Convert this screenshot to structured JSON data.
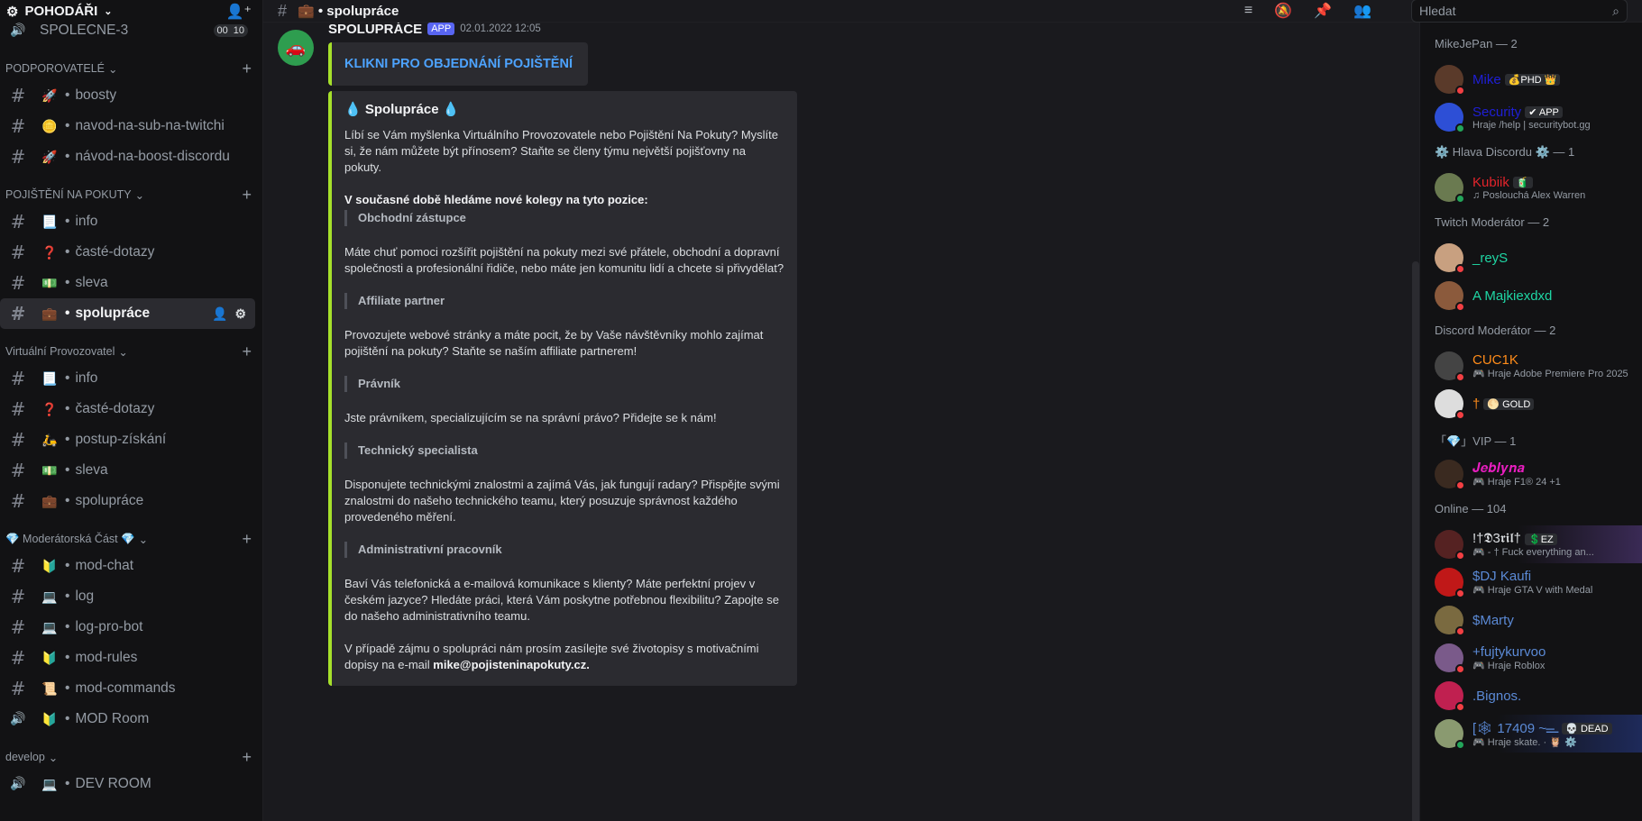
{
  "server": {
    "name": "POHODÁŘI"
  },
  "topbar": {
    "channel": "💼 • spolupráce",
    "search_placeholder": "Hledat"
  },
  "sidebar": {
    "top_channel": {
      "name": "SPOLECNE-3",
      "counts": [
        "00",
        "10"
      ]
    },
    "categories": [
      {
        "label": "PODPOROVATELÉ",
        "channels": [
          {
            "emoji": "🚀",
            "name": "boosty"
          },
          {
            "emoji": "🪙",
            "name": "navod-na-sub-na-twitchi"
          },
          {
            "emoji": "🚀",
            "name": "návod-na-boost-discordu"
          }
        ]
      },
      {
        "label": "POJIŠTĚNÍ NA POKUTY",
        "channels": [
          {
            "emoji": "📃",
            "name": "info"
          },
          {
            "emoji": "❓",
            "name": "časté-dotazy"
          },
          {
            "emoji": "💵",
            "name": "sleva"
          },
          {
            "emoji": "💼",
            "name": "spolupráce",
            "active": true
          }
        ]
      },
      {
        "label": "Virtuální Provozovatel",
        "channels": [
          {
            "emoji": "📃",
            "name": "info"
          },
          {
            "emoji": "❓",
            "name": "časté-dotazy"
          },
          {
            "emoji": "🛵",
            "name": "postup-získání"
          },
          {
            "emoji": "💵",
            "name": "sleva"
          },
          {
            "emoji": "💼",
            "name": "spolupráce"
          }
        ]
      },
      {
        "label": "💎 Moderátorská Část 💎",
        "channels": [
          {
            "emoji": "🔰",
            "name": "mod-chat"
          },
          {
            "emoji": "💻",
            "name": "log"
          },
          {
            "emoji": "💻",
            "name": "log-pro-bot"
          },
          {
            "emoji": "🔰",
            "name": "mod-rules"
          },
          {
            "emoji": "📜",
            "name": "mod-commands"
          },
          {
            "emoji": "🔰",
            "name": "MOD Room",
            "voice": true
          }
        ]
      },
      {
        "label": "develop",
        "channels": [
          {
            "emoji": "💻",
            "name": "DEV ROOM",
            "voice": true
          }
        ]
      }
    ]
  },
  "message": {
    "author": "SPOLUPRÁCE",
    "tag": "APP",
    "timestamp": "02.01.2022 12:05",
    "button_text": "KLIKNI PRO OBJEDNÁNÍ POJIŠTĚNÍ",
    "embed": {
      "title": "💧 Spolupráce 💧",
      "intro": "Líbí se Vám myšlenka Virtuálního Provozovatele nebo Pojištění Na Pokuty? Myslíte si, že nám můžete být přínosem? Staňte se členy týmu největší pojišťovny na pokuty.",
      "heading": "V současné době hledáme nové kolegy na tyto pozice:",
      "positions": [
        {
          "title": "Obchodní zástupce",
          "text": "Máte chuť pomoci rozšířit pojištění na pokuty mezi své přátele, obchodní a dopravní společnosti a profesionální řidiče, nebo máte jen komunitu lidí a chcete si přivydělat?"
        },
        {
          "title": "Affiliate partner",
          "text": "Provozujete webové stránky a máte pocit, že by Vaše návštěvníky mohlo zajímat pojištění na pokuty? Staňte se naším affiliate partnerem!"
        },
        {
          "title": "Právník",
          "text": "Jste právníkem, specializujícím se na správní právo? Přidejte se k nám!"
        },
        {
          "title": "Technický specialista",
          "text": "Disponujete technickými znalostmi a zajímá Vás, jak fungují radary? Přispějte svými znalostmi do našeho technického teamu, který posuzuje správnost každého provedeného měření."
        },
        {
          "title": "Administrativní pracovník",
          "text": "Baví Vás telefonická a e-mailová komunikace s klienty? Máte perfektní projev v českém jazyce? Hledáte práci, která Vám poskytne potřebnou flexibilitu? Zapojte se do našeho administrativního teamu."
        }
      ],
      "outro": "V případě zájmu o spolupráci nám prosím zasílejte své životopisy s motivačními dopisy na e-mail",
      "email": "mike@pojisteninapokuty.cz."
    }
  },
  "members": [
    {
      "label": "MikeJePan — 2",
      "list": [
        {
          "name": "Mike",
          "color": "#1f1fd6",
          "tag": "💰PHD 👑",
          "status": "dnd",
          "av": "#5a3a2a"
        },
        {
          "name": "Security",
          "color": "#1f1fd6",
          "tag": "✔ APP",
          "sub": "Hraje /help | securitybot.gg",
          "status": "on",
          "av": "#2d4fd6"
        }
      ]
    },
    {
      "label": "⚙️ Hlava Discordu ⚙️ — 1",
      "list": [
        {
          "name": "Kubiik",
          "color": "#e3242b",
          "tag": "🧃",
          "sub": "♫ Poslouchá Alex Warren",
          "status": "on",
          "av": "#6a7a50"
        }
      ]
    },
    {
      "label": "Twitch Moderátor — 2",
      "list": [
        {
          "name": "_reyS",
          "color": "#1fd6a4",
          "status": "dnd",
          "av": "#c8a080"
        },
        {
          "name": "A Majkiexdxd",
          "color": "#1fd6a4",
          "status": "dnd",
          "av": "#8b5a3c"
        }
      ]
    },
    {
      "label": "Discord Moderátor — 2",
      "list": [
        {
          "name": "CUC1K",
          "color": "#ff8c1a",
          "sub": "🎮 Hraje Adobe Premiere Pro 2025",
          "status": "dnd",
          "av": "#444"
        },
        {
          "name": "†",
          "color": "#ff8c1a",
          "tag": "🌕 GOLD",
          "status": "dnd",
          "av": "#ddd"
        }
      ]
    },
    {
      "label": "「💎」VIP — 1",
      "list": [
        {
          "name": "𝑱𝒆𝒃𝒍𝒚𝒏𝒂",
          "color": "#e91ec0",
          "sub": "🎮 Hraje F1® 24 +1",
          "status": "dnd",
          "av": "#3a2a20"
        }
      ]
    },
    {
      "label": "Online — 104",
      "list": [
        {
          "name": "!†𝕯3𝖗𝖎𝖑†",
          "color": "#dbdee1",
          "tag": "💲EZ",
          "sub": "🎮 - † Fuck everything an...",
          "status": "dnd",
          "av": "#552222",
          "banner": true
        },
        {
          "name": "$DJ Kaufi",
          "color": "#5b8ad6",
          "sub": "🎮 Hraje GTA V with Medal",
          "status": "dnd",
          "av": "#c01818"
        },
        {
          "name": "$Marty",
          "color": "#5b8ad6",
          "status": "dnd",
          "av": "#7a6a40"
        },
        {
          "name": "+fujtykurvoo",
          "color": "#5b8ad6",
          "sub": "🎮 Hraje Roblox",
          "status": "dnd",
          "av": "#7a5a8a"
        },
        {
          "name": ".Bignos.",
          "color": "#5b8ad6",
          "status": "dnd",
          "av": "#c02050"
        },
        {
          "name": "[🕸 17409 ~ـ̶ــ",
          "color": "#5b8ad6",
          "tag": "💀 DEAD",
          "sub": "🎮 Hraje skate. · 🦉 ⚙️",
          "status": "on",
          "av": "#8a9a70",
          "banner2": true
        }
      ]
    }
  ]
}
